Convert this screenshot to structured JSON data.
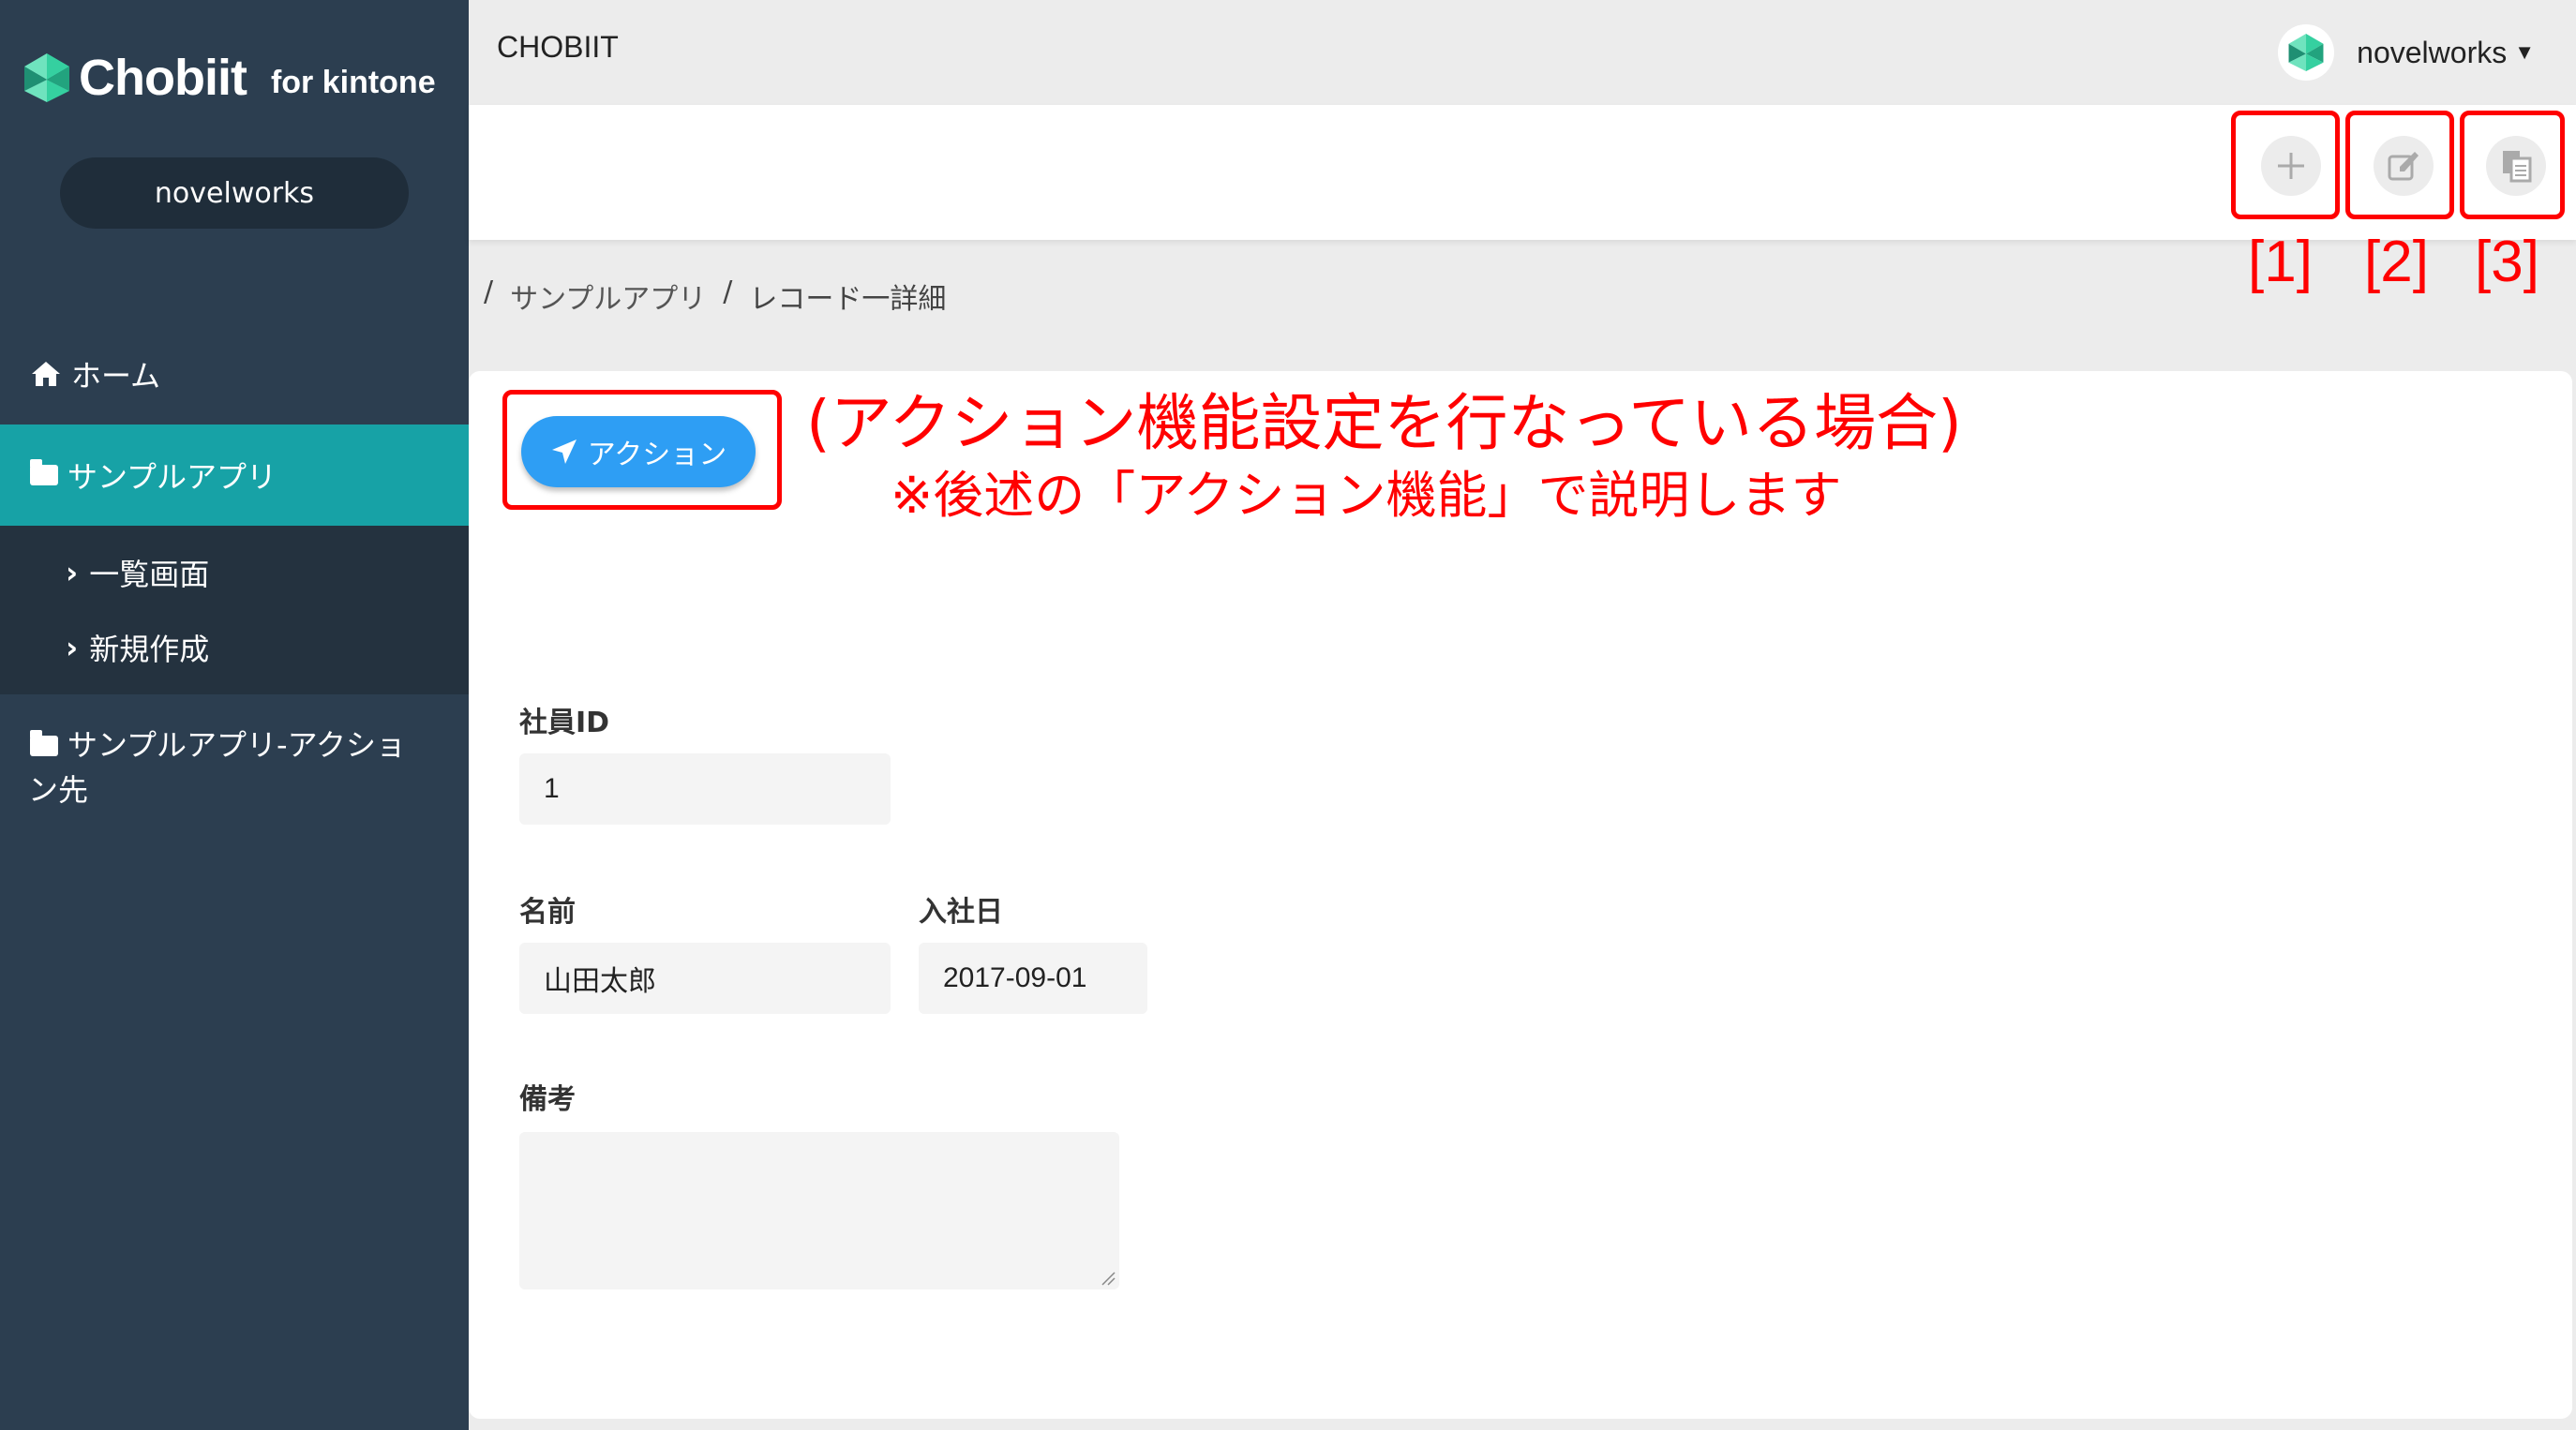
{
  "sidebar": {
    "logo_text": "Chobiit",
    "logo_sub": "for kintone",
    "user": "novelworks",
    "home_label": "ホーム",
    "app_label": "サンプルアプリ",
    "sub_items": [
      "一覧画面",
      "新規作成"
    ],
    "action_app_label_line1": "サンプルアプリ-アクショ",
    "action_app_label_line2": "ン先"
  },
  "topbar": {
    "app_title": "CHOBIIT",
    "account_name": "novelworks"
  },
  "toolbar": {
    "labels": [
      "[1]",
      "[2]",
      "[3]"
    ],
    "icons": [
      "plus-icon",
      "edit-icon",
      "copy-icon"
    ]
  },
  "breadcrumb": {
    "sep": "/",
    "app": "サンプルアプリ",
    "current": "レコード一詳細"
  },
  "action": {
    "button_label": "アクション",
    "note_line1": "(アクション機能設定を行なっている場合)",
    "note_line2": "※後述の「アクション機能」で説明します"
  },
  "form": {
    "employee_id_label": "社員ID",
    "employee_id_value": "1",
    "name_label": "名前",
    "name_value": "山田太郎",
    "join_date_label": "入社日",
    "join_date_value": "2017-09-01",
    "remarks_label": "備考",
    "remarks_value": ""
  },
  "colors": {
    "sidebar_bg": "#2c3e50",
    "active_bg": "#17a2a6",
    "action_blue": "#2e9ef4",
    "highlight_red": "#ff0000"
  }
}
